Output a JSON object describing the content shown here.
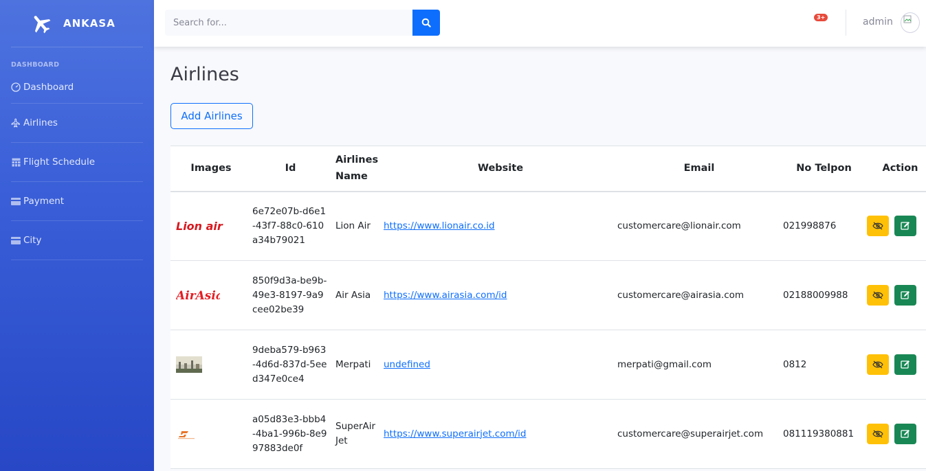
{
  "brand": {
    "name": "ANKASA",
    "icon": "airplane-icon"
  },
  "sidebar": {
    "heading": "DASHBOARD",
    "items": [
      {
        "label": "Dashboard",
        "icon": "gauge-icon"
      },
      {
        "label": "Airlines",
        "icon": "airplane-icon"
      },
      {
        "label": "Flight Schedule",
        "icon": "table-icon"
      },
      {
        "label": "Payment",
        "icon": "card-icon"
      },
      {
        "label": "City",
        "icon": "card-icon"
      }
    ]
  },
  "topbar": {
    "search_placeholder": "Search for...",
    "alert_badge": "3+",
    "user_name": "admin"
  },
  "page": {
    "title": "Airlines",
    "add_button": "Add Airlines"
  },
  "table": {
    "headers": [
      "Images",
      "Id",
      "Airlines Name",
      "Website",
      "Email",
      "No Telpon",
      "Action"
    ],
    "rows": [
      {
        "logo": "Lion air",
        "id": "6e72e07b-d6e1-43f7-88c0-610a34b79021",
        "name": "Lion Air",
        "website": "https://www.lionair.co.id",
        "email": "customercare@lionair.com",
        "phone": "021998876"
      },
      {
        "logo": "AirAsia",
        "id": "850f9d3a-be9b-49e3-8197-9a9cee02be39",
        "name": "Air Asia",
        "website": "https://www.airasia.com/id",
        "email": "customercare@airasia.com",
        "phone": "02188009988"
      },
      {
        "logo": "",
        "id": "9deba579-b963-4d6d-837d-5eed347e0ce4",
        "name": "Merpati",
        "website": "undefined",
        "email": "merpati@gmail.com",
        "phone": "0812"
      },
      {
        "logo": "",
        "id": "a05d83e3-bbb4-4ba1-996b-8e997883de0f",
        "name": "SuperAir Jet",
        "website": "https://www.superairjet.com/id",
        "email": "customercare@superairjet.com",
        "phone": "081119380881"
      }
    ]
  },
  "colors": {
    "sidebar": "#4e73df",
    "primary": "#0d6efd",
    "view": "#ffc107",
    "edit": "#198754",
    "danger": "#e74a3b"
  }
}
